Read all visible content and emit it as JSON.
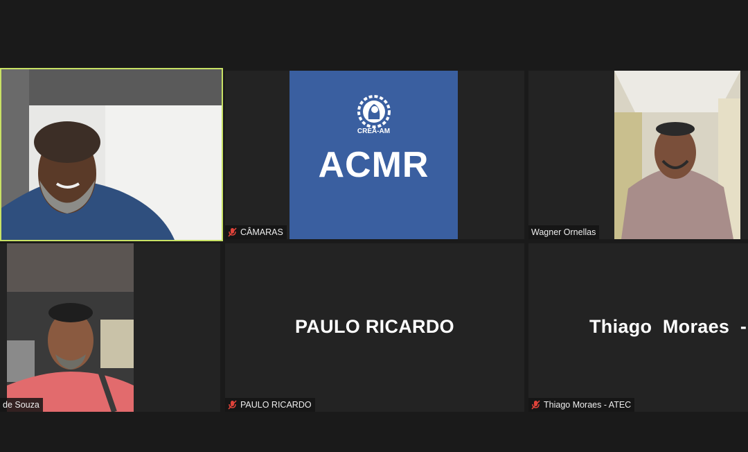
{
  "tiles": [
    {
      "id": "speaker",
      "name": "",
      "muted": false
    },
    {
      "id": "camaras",
      "name": "CÂMARAS",
      "muted": true,
      "logo": {
        "org": "CREA-AM",
        "title": "ACMR",
        "color": "#3a5fa0"
      }
    },
    {
      "id": "wagner",
      "name": "Wagner Ornellas",
      "muted": false
    },
    {
      "id": "souza",
      "name": "de Souza",
      "muted": false
    },
    {
      "id": "paulo",
      "name": "PAULO RICARDO",
      "display_name": "PAULO RICARDO",
      "muted": true
    },
    {
      "id": "thiago",
      "name": "Thiago Moraes - ATEC",
      "display_name": "Thiago  Moraes  -",
      "muted": true
    }
  ],
  "colors": {
    "active_speaker_border": "#c9e265",
    "muted_icon": "#e0433a",
    "background": "#1a1a1a"
  },
  "icons": {
    "mic_muted": "mic-muted-icon"
  }
}
